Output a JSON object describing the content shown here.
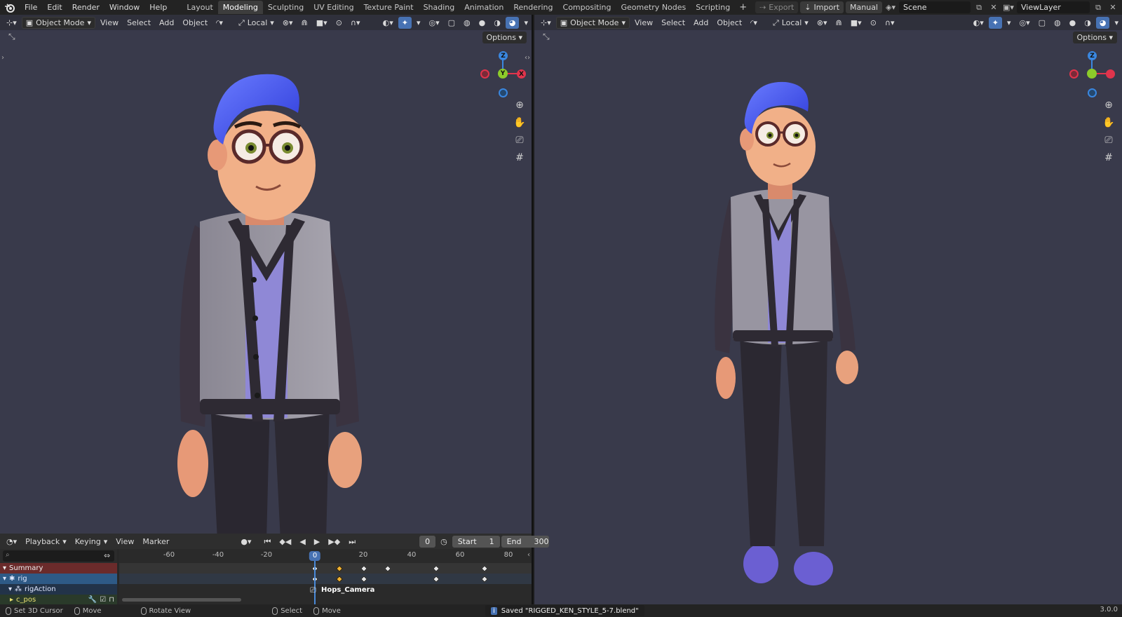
{
  "topbar": {
    "menus": [
      "File",
      "Edit",
      "Render",
      "Window",
      "Help"
    ],
    "workspaces": [
      "Layout",
      "Modeling",
      "Sculpting",
      "UV Editing",
      "Texture Paint",
      "Shading",
      "Animation",
      "Rendering",
      "Compositing",
      "Geometry Nodes",
      "Scripting"
    ],
    "active_workspace": "Modeling",
    "export_label": "Export",
    "import_label": "Import",
    "manual_label": "Manual",
    "scene": "Scene",
    "view_layer": "ViewLayer"
  },
  "viewport_header": {
    "mode": "Object Mode",
    "menus": [
      "View",
      "Select",
      "Add",
      "Object"
    ],
    "orientation": "Local",
    "options_label": "Options"
  },
  "gizmo": {
    "z": "Z",
    "y": "Y",
    "x": "X"
  },
  "dopesheet": {
    "menus": [
      "Playback",
      "Keying",
      "View",
      "Marker"
    ],
    "current_frame": "0",
    "start_label": "Start",
    "start_value": "1",
    "end_label": "End",
    "end_value": "300",
    "ruler_ticks": [
      "-60",
      "-40",
      "-20",
      "20",
      "40",
      "60",
      "80"
    ],
    "playhead_frame": "0",
    "channels": [
      "Summary",
      "rig",
      "rigAction",
      "c_pos"
    ],
    "marker": "Hops_Camera"
  },
  "statusbar": {
    "set_cursor": "Set 3D Cursor",
    "move": "Move",
    "rotate": "Rotate View",
    "select": "Select",
    "move2": "Move",
    "message": "Saved \"RIGGED_KEN_STYLE_5-7.blend\"",
    "version": "3.0.0"
  },
  "colors": {
    "viewport_bg": "#393a4b",
    "active_blue": "#4772b3",
    "keyframe_selected": "#f2b230",
    "axis_x": "#e0344c",
    "axis_y": "#8ccc2a",
    "axis_z": "#3a87e0"
  }
}
